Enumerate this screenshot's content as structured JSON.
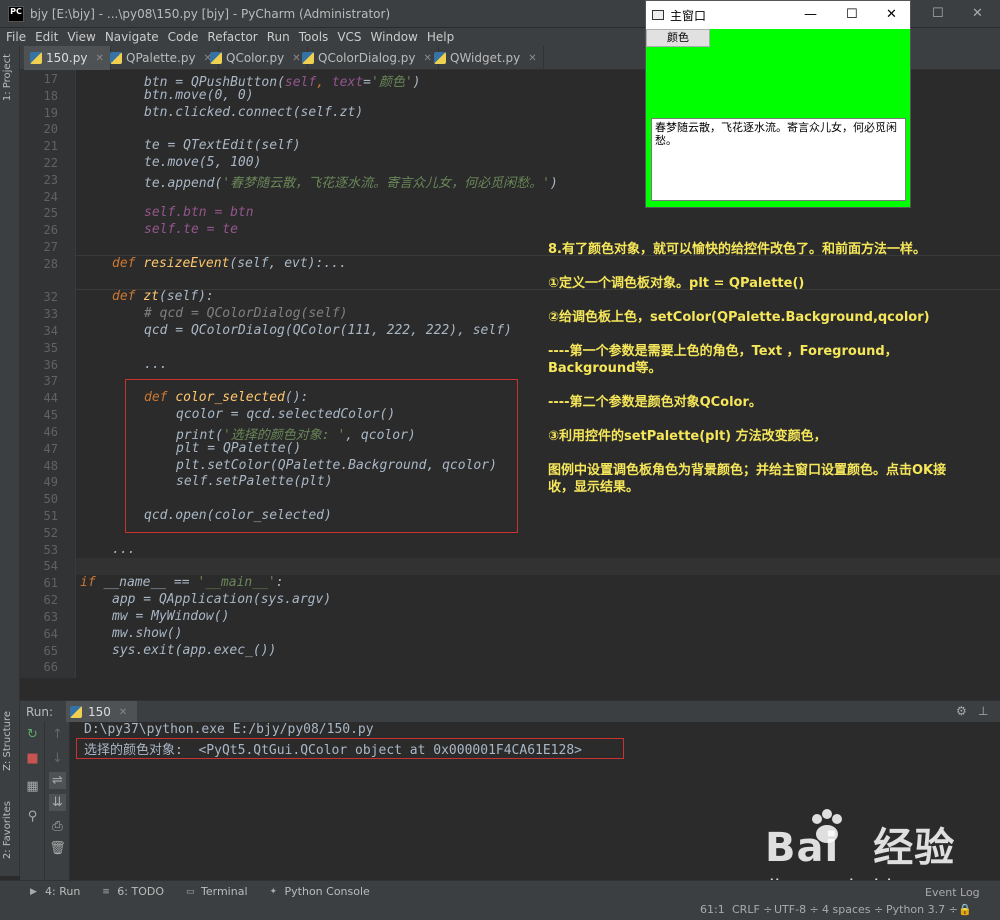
{
  "window": {
    "title": "bjy [E:\\bjy] - ...\\py08\\150.py [bjy] - PyCharm (Administrator)",
    "logo": "PC",
    "controls": [
      "—",
      "☐",
      "✕"
    ]
  },
  "menu": [
    "File",
    "Edit",
    "View",
    "Navigate",
    "Code",
    "Refactor",
    "Run",
    "Tools",
    "VCS",
    "Window",
    "Help"
  ],
  "tabs": [
    {
      "label": "150.py",
      "active": true
    },
    {
      "label": "QPalette.py",
      "active": false
    },
    {
      "label": "QColor.py",
      "active": false
    },
    {
      "label": "QColorDialog.py",
      "active": false
    },
    {
      "label": "QWidget.py",
      "active": false
    }
  ],
  "sidebar": {
    "project": "1: Project",
    "structure": "Z: Structure",
    "favorites": "2: Favorites"
  },
  "line_numbers": [
    "17",
    "18",
    "19",
    "20",
    "21",
    "22",
    "23",
    "24",
    "25",
    "26",
    "27",
    "28",
    "32",
    "33",
    "34",
    "35",
    "36",
    "37",
    "44",
    "45",
    "46",
    "47",
    "48",
    "49",
    "50",
    "51",
    "52",
    "53",
    "54",
    "61",
    "62",
    "63",
    "64",
    "65",
    "66",
    "67"
  ],
  "code": {
    "l17a": "btn",
    "l17b": " = ",
    "l17c": "QPushButton",
    "l17d": "(",
    "l17e": "self",
    ",": ", ",
    "l17f": "text",
    "l17g": "=",
    "l17h": "'颜色'",
    "l17i": ")",
    "l18": "btn.move(0, 0)",
    "l19": "btn.clicked.connect(self.zt)",
    "l21a": "te = ",
    "l21b": "QTextEdit",
    "l21c": "(self)",
    "l22": "te.move(5, 100)",
    "l23a": "te.append(",
    "l23b": "'春梦随云散，飞花逐水流。寄言众儿女，何必觅闲愁。'",
    "l23c": ")",
    "l25": "self.btn = btn",
    "l26": "self.te = te",
    "l28a": "def ",
    "l28b": "resizeEvent",
    "l28c": "(self, evt):...",
    "l33a": "def ",
    "l33b": "zt",
    "l33c": "(self):",
    "l34": "# qcd = QColorDialog(self)",
    "l35": "qcd = QColorDialog(QColor(111, 222, 222), self)",
    "l37": "...",
    "l45a": "def ",
    "l45b": "color_selected",
    "l45c": "():",
    "l46": "qcolor = qcd.selectedColor()",
    "l47a": "print(",
    "l47b": "'选择的颜色对象: '",
    ", qcolor)": ", qcolor)",
    "l48": "plt = QPalette()",
    "l49": "plt.setColor(QPalette.Background, qcolor)",
    "l50": "self.setPalette(plt)",
    "l52": "qcd.open(color_selected)",
    "l54": "...",
    "l62a": "if ",
    "l62b": "__name__",
    " == ": " == ",
    "l62c": "'__main__'",
    ":": ":",
    "l63": "app = QApplication(sys.argv)",
    "l64": "mw = MyWindow()",
    "l65": "mw.show()",
    "l66": "sys.exit(app.exec_())"
  },
  "annotations": [
    "8.有了颜色对象，就可以愉快的给控件改色了。和前面方法一样。",
    "①定义一个调色板对象。plt = QPalette()",
    "②给调色板上色，setColor(QPalette.Background,qcolor)",
    "----第一个参数是需要上色的角色，Text ，Foreground，Background等。",
    "----第二个参数是颜色对象QColor。",
    "③利用控件的setPalette(plt) 方法改变颜色，",
    "图例中设置调色板角色为背景颜色；并给主窗口设置颜色。点击OK接收，显示结果。"
  ],
  "qt_window": {
    "title": "主窗口",
    "button": "颜色",
    "text": "春梦随云散，飞花逐水流。寄言众儿女，何必觅闲愁。",
    "bg": "#00ff00"
  },
  "run": {
    "label": "Run:",
    "tab": "150",
    "cmd": "D:\\py37\\python.exe E:/bjy/py08/150.py",
    "output": "选择的颜色对象:  <PyQt5.QtGui.QColor object at 0x000001F4CA61E128>"
  },
  "bottom_tabs": [
    "4: Run",
    "6: TODO",
    "Terminal",
    "Python Console"
  ],
  "status": {
    "pos": "61:1",
    "crlf": "CRLF ÷",
    "enc": "UTF-8 ÷",
    "indent": "4 spaces ÷",
    "py": "Python 3.7 ÷",
    "event": "Event Log"
  },
  "watermark": {
    "brand": "Bai",
    "brand2": "经验",
    "url": "jingyan.baidu.com"
  }
}
